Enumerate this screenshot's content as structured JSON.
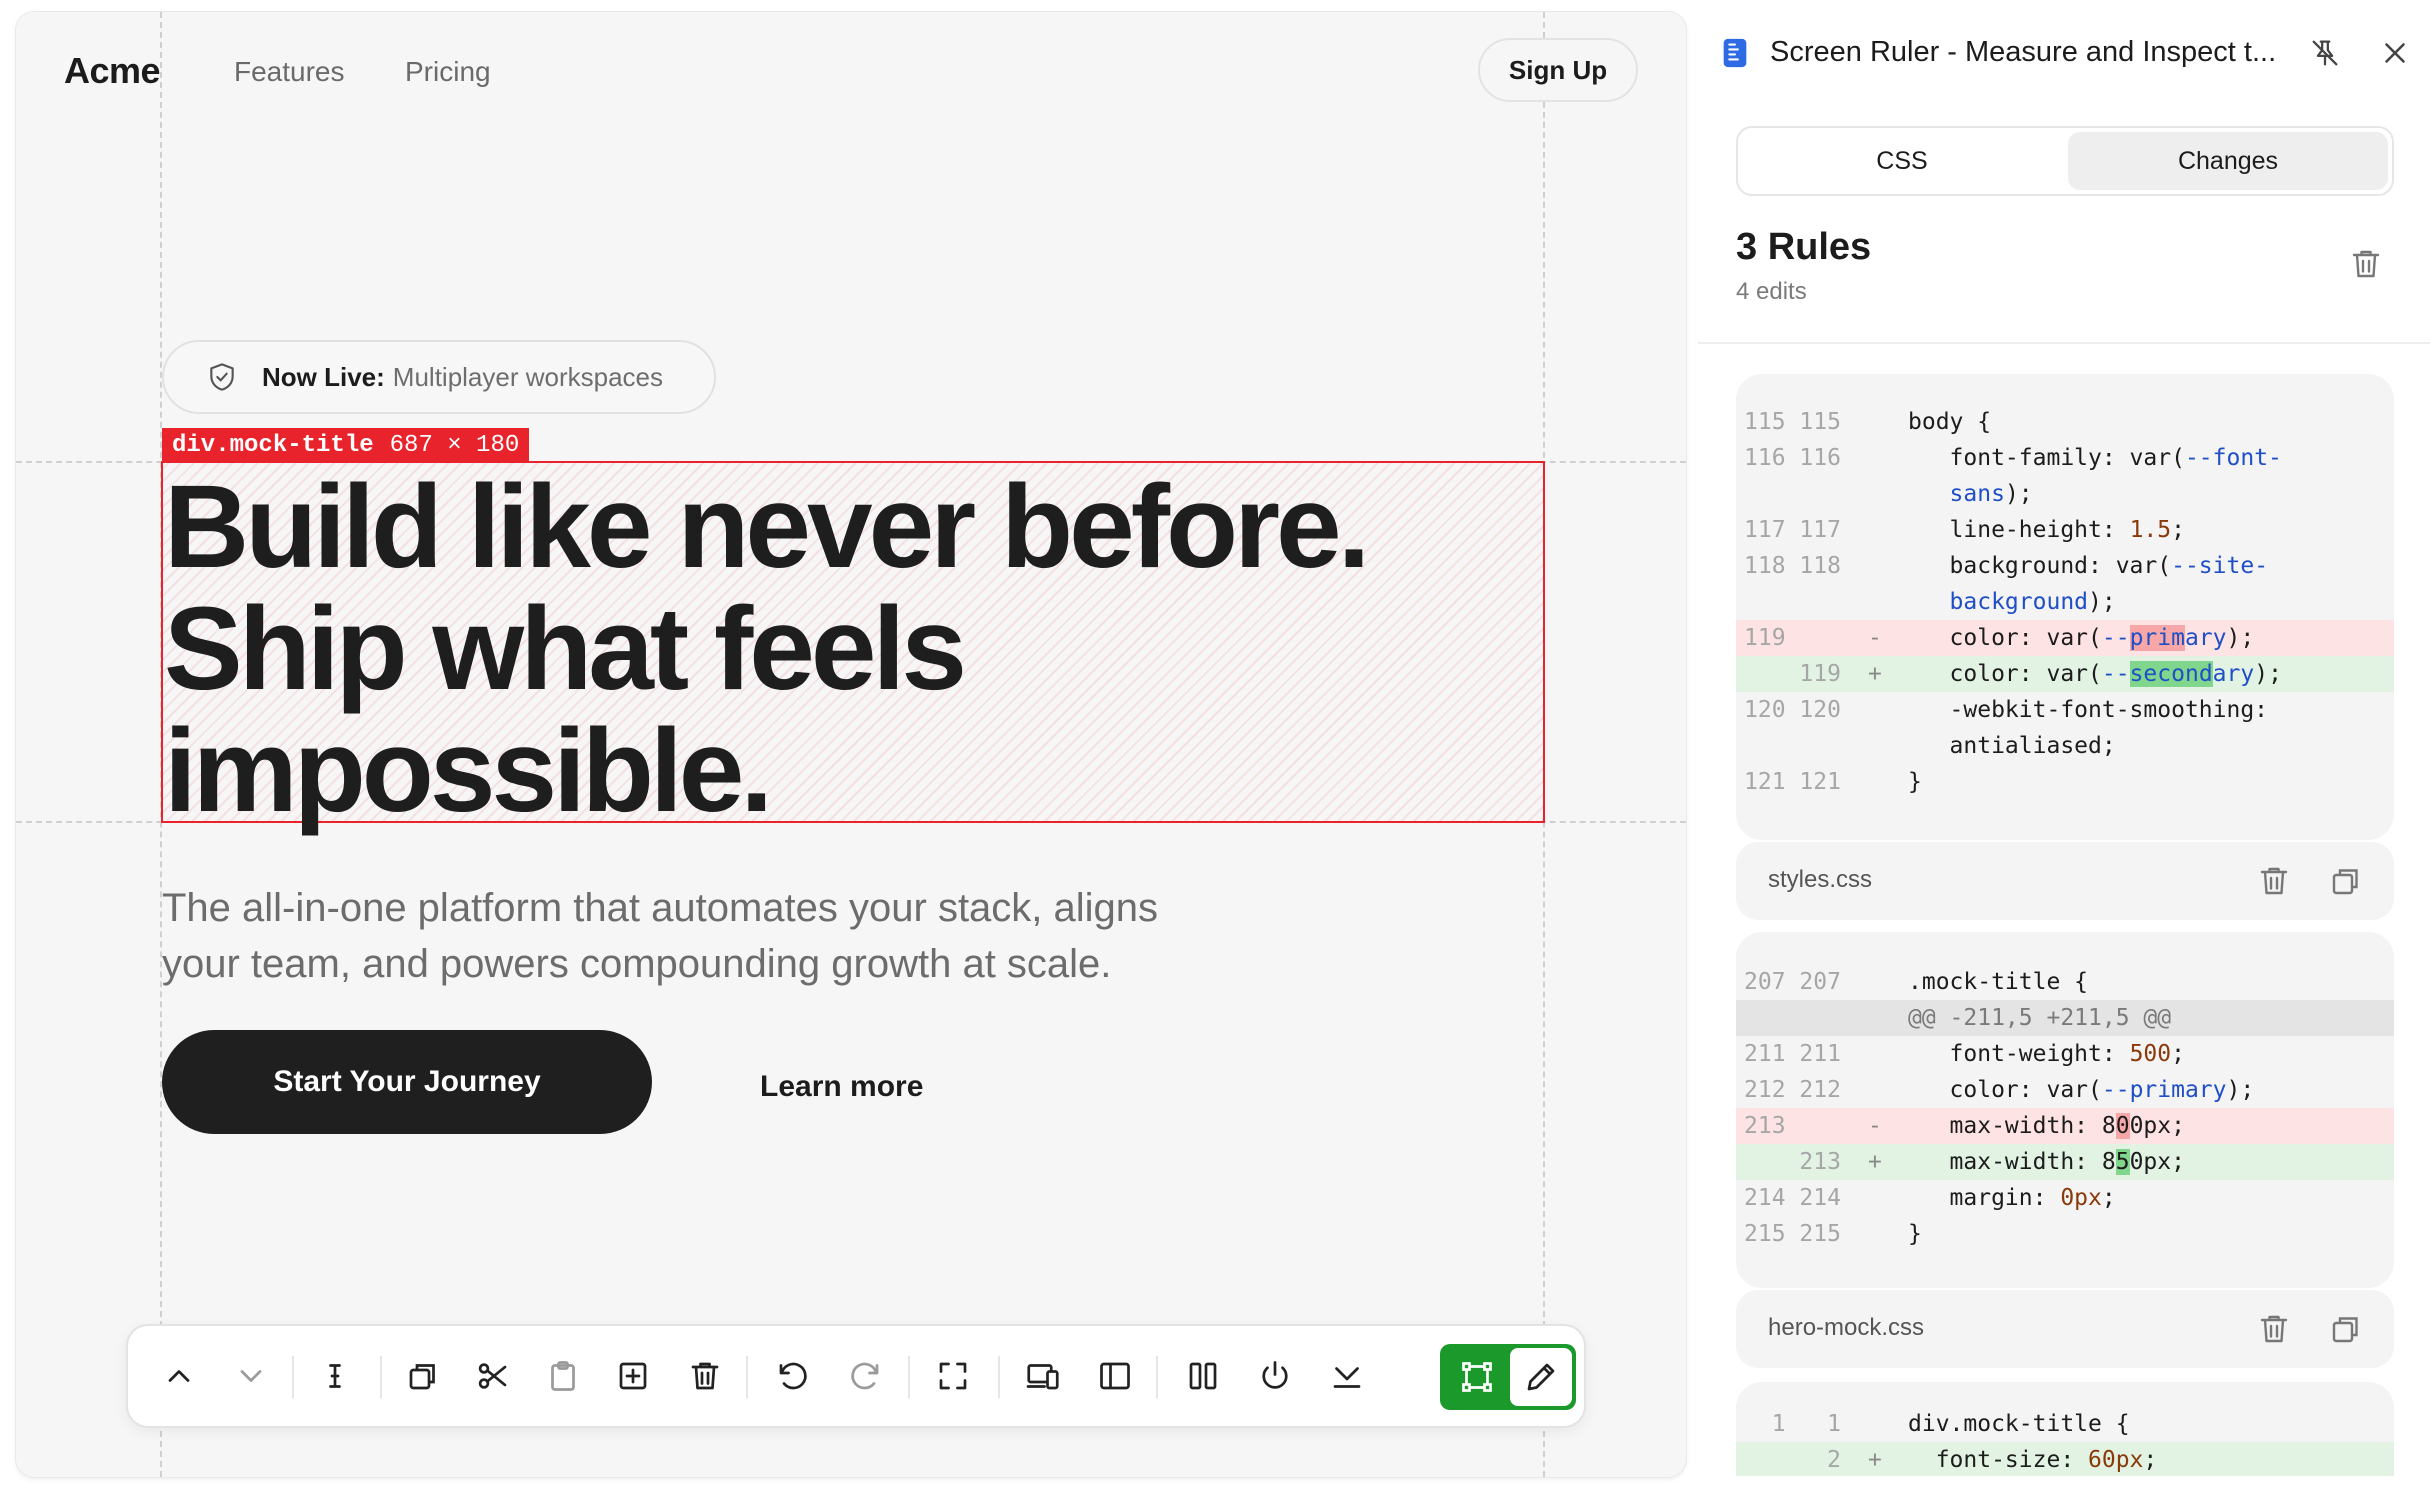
{
  "site": {
    "logo": "Acme",
    "nav": [
      "Features",
      "Pricing"
    ],
    "signup_label": "Sign Up",
    "badge": {
      "strong": "Now Live:",
      "text": "Multiplayer workspaces"
    },
    "measure_tag": {
      "selector": "div.mock-title",
      "size": "687 × 180"
    },
    "title_lines": [
      "Build like never before.",
      "Ship what feels",
      "impossible."
    ],
    "subtitle_lines": [
      "The all-in-one platform that automates your stack, aligns",
      "your team, and powers compounding growth at scale."
    ],
    "cta_primary": "Start Your Journey",
    "cta_secondary": "Learn more"
  },
  "toolbar": {
    "items": [
      "chevron-up-icon",
      "chevron-down-icon",
      "text-cursor-icon",
      "duplicate-icon",
      "scissors-icon",
      "clipboard-icon",
      "add-element-icon",
      "trash-icon",
      "undo-icon",
      "redo-icon",
      "fullscreen-icon",
      "devices-icon",
      "sidebar-icon",
      "columns-icon",
      "power-icon",
      "download-icon",
      "select-frame-icon",
      "edit-pencil-icon"
    ],
    "active_color": "#1b9a2b"
  },
  "panel": {
    "title": "Screen Ruler - Measure and Inspect t...",
    "tabs": [
      "CSS",
      "Changes"
    ],
    "active_tab": "Changes",
    "rules_count": "3 Rules",
    "edits": "4 edits",
    "diffs": [
      {
        "file": "styles.css",
        "lines": [
          {
            "old": "115",
            "new": "115",
            "sign": "",
            "type": "ctx",
            "code": "body {"
          },
          {
            "old": "116",
            "new": "116",
            "sign": "",
            "type": "ctx",
            "code": "   font-family: var(--font-"
          },
          {
            "old": "",
            "new": "",
            "sign": "",
            "type": "ctx",
            "code": "   sans);"
          },
          {
            "old": "117",
            "new": "117",
            "sign": "",
            "type": "ctx",
            "code": "   line-height: 1.5;"
          },
          {
            "old": "118",
            "new": "118",
            "sign": "",
            "type": "ctx",
            "code": "   background: var(--site-"
          },
          {
            "old": "",
            "new": "",
            "sign": "",
            "type": "ctx",
            "code": "   background);"
          },
          {
            "old": "119",
            "new": "",
            "sign": "-",
            "type": "del",
            "code": "   color: var(--primary);"
          },
          {
            "old": "",
            "new": "119",
            "sign": "+",
            "type": "add",
            "code": "   color: var(--secondary);"
          },
          {
            "old": "120",
            "new": "120",
            "sign": "",
            "type": "ctx",
            "code": "   -webkit-font-smoothing:"
          },
          {
            "old": "",
            "new": "",
            "sign": "",
            "type": "ctx",
            "code": "   antialiased;"
          },
          {
            "old": "121",
            "new": "121",
            "sign": "",
            "type": "ctx",
            "code": "}"
          }
        ]
      },
      {
        "file": "hero-mock.css",
        "lines": [
          {
            "old": "207",
            "new": "207",
            "sign": "",
            "type": "ctx",
            "code": ".mock-title {"
          },
          {
            "old": "",
            "new": "",
            "sign": "",
            "type": "hunk",
            "code": "@@ -211,5 +211,5 @@"
          },
          {
            "old": "211",
            "new": "211",
            "sign": "",
            "type": "ctx",
            "code": "   font-weight: 500;"
          },
          {
            "old": "212",
            "new": "212",
            "sign": "",
            "type": "ctx",
            "code": "   color: var(--primary);"
          },
          {
            "old": "213",
            "new": "",
            "sign": "-",
            "type": "del",
            "code": "   max-width: 800px;"
          },
          {
            "old": "",
            "new": "213",
            "sign": "+",
            "type": "add",
            "code": "   max-width: 850px;"
          },
          {
            "old": "214",
            "new": "214",
            "sign": "",
            "type": "ctx",
            "code": "   margin: 0px;"
          },
          {
            "old": "215",
            "new": "215",
            "sign": "",
            "type": "ctx",
            "code": "}"
          }
        ]
      },
      {
        "file": "",
        "lines": [
          {
            "old": "1",
            "new": "1",
            "sign": "",
            "type": "ctx",
            "code": "div.mock-title {"
          },
          {
            "old": "",
            "new": "2",
            "sign": "+",
            "type": "add",
            "code": "  font-size: 60px;"
          }
        ]
      }
    ]
  },
  "colors": {
    "accent_red": "#e8232b",
    "primary_dark": "#1f1f1f",
    "toggle_green": "#1b9a2b",
    "diff_del_bg": "#fde3e3",
    "diff_add_bg": "#e2f3e3",
    "var_blue": "#1f4fc7"
  }
}
